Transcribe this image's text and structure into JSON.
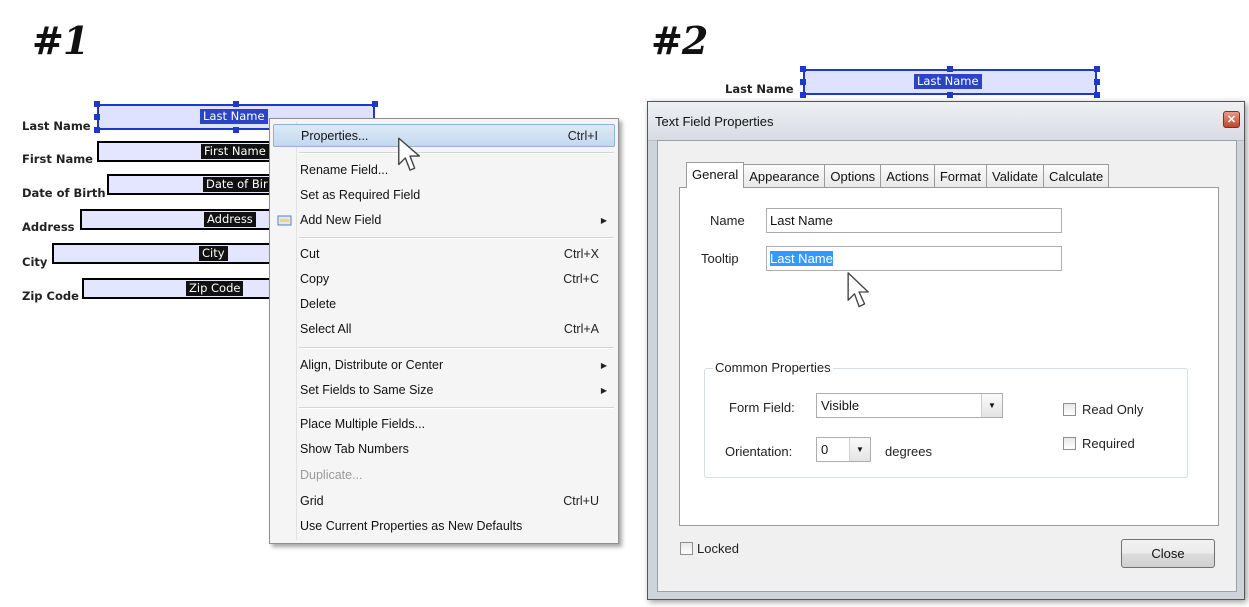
{
  "step1": {
    "title": "#1"
  },
  "step2": {
    "title": "#2"
  },
  "form": {
    "fields": [
      {
        "label": "Last Name",
        "value": "Last Name"
      },
      {
        "label": "First Name",
        "value": "First Name"
      },
      {
        "label": "Date of Birth",
        "value": "Date of Bir"
      },
      {
        "label": "Address",
        "value": "Address"
      },
      {
        "label": "City",
        "value": "City"
      },
      {
        "label": "Zip Code",
        "value": "Zip Code"
      }
    ]
  },
  "context_menu": {
    "items": [
      {
        "label": "Properties...",
        "shortcut": "Ctrl+I",
        "highlighted": true
      },
      {
        "label": "Rename Field..."
      },
      {
        "label": "Set as Required Field"
      },
      {
        "label": "Add New Field",
        "submenu": true
      },
      {
        "label": "Cut",
        "shortcut": "Ctrl+X"
      },
      {
        "label": "Copy",
        "shortcut": "Ctrl+C"
      },
      {
        "label": "Delete"
      },
      {
        "label": "Select All",
        "shortcut": "Ctrl+A"
      },
      {
        "label": "Align, Distribute or Center",
        "submenu": true
      },
      {
        "label": "Set Fields to Same Size",
        "submenu": true
      },
      {
        "label": "Place Multiple Fields..."
      },
      {
        "label": "Show Tab Numbers"
      },
      {
        "label": "Duplicate...",
        "disabled": true
      },
      {
        "label": "Grid",
        "shortcut": "Ctrl+U"
      },
      {
        "label": "Use Current Properties as New Defaults"
      }
    ]
  },
  "panel2_field": {
    "label": "Last Name",
    "value": "Last Name"
  },
  "dialog": {
    "title": "Text Field Properties",
    "tabs": [
      "General",
      "Appearance",
      "Options",
      "Actions",
      "Format",
      "Validate",
      "Calculate"
    ],
    "active_tab": "General",
    "name_label": "Name",
    "name_value": "Last Name",
    "tooltip_label": "Tooltip",
    "tooltip_value": "Last Name",
    "common_properties": "Common Properties",
    "form_field_label": "Form Field:",
    "form_field_value": "Visible",
    "orientation_label": "Orientation:",
    "orientation_value": "0",
    "degrees": "degrees",
    "read_only": "Read Only",
    "required": "Required",
    "locked": "Locked",
    "close_button": "Close"
  },
  "icons": [
    "add-field-icon",
    "submenu-arrow-icon",
    "dropdown-arrow-icon",
    "close-icon",
    "hand-cursor-icon",
    "arrow-cursor-icon"
  ]
}
